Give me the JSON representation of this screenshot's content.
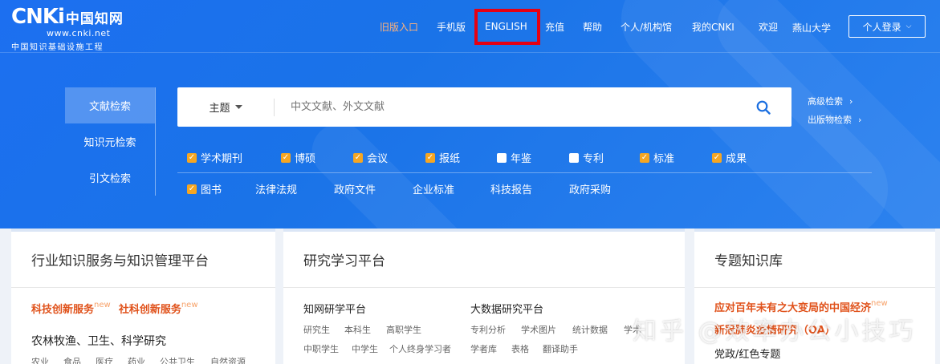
{
  "logo": {
    "brand": "CNKi",
    "brand_cn": "中国知网",
    "url": "www.cnki.net",
    "slogan": "中国知识基础设施工程"
  },
  "nav": {
    "old": "旧版入口",
    "mobile": "手机版",
    "english": "ENGLISH",
    "recharge": "充值",
    "help": "帮助",
    "personal": "个人/机构馆",
    "mycnki": "我的CNKI",
    "welcome": "欢迎",
    "org": "燕山大学",
    "login": "个人登录"
  },
  "search": {
    "tabs": [
      "文献检索",
      "知识元检索",
      "引文检索"
    ],
    "field": "主题",
    "placeholder": "中文文献、外文文献",
    "advanced": "高级检索",
    "publication": "出版物检索"
  },
  "filters": {
    "row1": [
      {
        "label": "学术期刊",
        "checked": true
      },
      {
        "label": "博硕",
        "checked": true
      },
      {
        "label": "会议",
        "checked": true
      },
      {
        "label": "报纸",
        "checked": true
      },
      {
        "label": "年鉴",
        "checked": false
      },
      {
        "label": "专利",
        "checked": false
      },
      {
        "label": "标准",
        "checked": true
      },
      {
        "label": "成果",
        "checked": true
      }
    ],
    "row2_check": {
      "label": "图书",
      "checked": true
    },
    "row2_plain": [
      "法律法规",
      "政府文件",
      "企业标准",
      "科技报告",
      "政府采购"
    ]
  },
  "cards": {
    "industry": {
      "title": "行业知识服务与知识管理平台",
      "red1": "科技创新服务",
      "red2": "社科创新服务",
      "new": "new",
      "section": "农林牧渔、卫生、科学研究",
      "tags": [
        "农业",
        "食品",
        "医疗",
        "药业",
        "公共卫生",
        "自然资源"
      ]
    },
    "research": {
      "title": "研究学习平台",
      "left_title": "知网研学平台",
      "left_sub1": [
        "研究生",
        "本科生",
        "高职学生"
      ],
      "left_sub2": [
        "中职学生",
        "中学生",
        "个人终身学习者"
      ],
      "right_title": "大数据研究平台",
      "right_sub1": [
        "专利分析",
        "学术图片",
        "统计数据",
        "学术"
      ],
      "right_sub2": [
        "学者库",
        "表格",
        "翻译助手"
      ]
    },
    "special": {
      "title": "专题知识库",
      "red1": "应对百年未有之大变局的中国经济",
      "new": "new",
      "red2": "新冠肺炎疫情研究（OA）",
      "item": "党政/红色专题"
    }
  },
  "watermark": "知乎 @效率办公小技巧",
  "colors": {
    "primary": "#1a73e8",
    "highlight": "#e60012",
    "checkbox": "#f5a623",
    "red_text": "#e0521b"
  }
}
